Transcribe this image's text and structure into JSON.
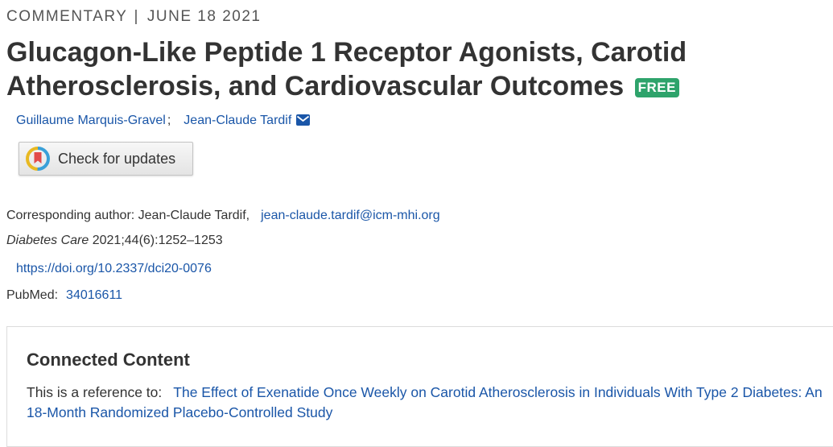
{
  "article": {
    "type": "COMMENTARY",
    "separator": "|",
    "date": "JUNE 18 2021",
    "title": "Glucagon-Like Peptide 1 Receptor Agonists, Carotid Atherosclerosis, and Cardiovascular Outcomes",
    "badge": "FREE",
    "authors": [
      {
        "name": "Guillaume Marquis-Gravel",
        "suffix": ";"
      },
      {
        "name": "Jean-Claude Tardif"
      }
    ],
    "check_updates_label": "Check for updates",
    "corresponding": {
      "label": "Corresponding author: Jean-Claude Tardif,",
      "email": "jean-claude.tardif@icm-mhi.org"
    },
    "citation": {
      "journal": "Diabetes Care",
      "details": " 2021;44(6):1252–1253"
    },
    "doi": "https://doi.org/10.2337/dci20-0076",
    "pubmed": {
      "label": "PubMed:",
      "id": "34016611"
    }
  },
  "connected": {
    "heading": "Connected Content",
    "prefix": "This is a reference to:",
    "link": "The Effect of Exenatide Once Weekly on Carotid Atherosclerosis in Individuals With Type 2 Diabetes: An 18-Month Randomized Placebo-Controlled Study"
  },
  "colors": {
    "link": "#1a56a8",
    "badge": "#2ea36b"
  },
  "icons": [
    "envelope-icon",
    "crossmark-icon"
  ]
}
